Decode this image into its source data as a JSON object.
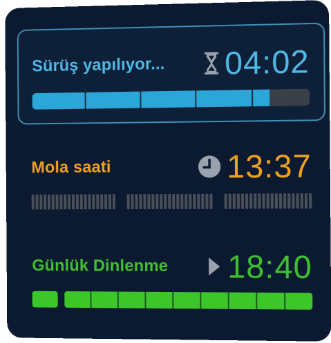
{
  "sections": {
    "driving": {
      "label": "Sürüş yapılıyor...",
      "time": "04:02",
      "icon": "hourglass-icon",
      "color": "#4fb8e6",
      "progress_fraction": 0.86
    },
    "break": {
      "label": "Mola saati",
      "time": "13:37",
      "icon": "clock-icon",
      "color": "#f0a020"
    },
    "rest": {
      "label": "Günlük Dinlenme",
      "time": "18:40",
      "icon": "play-arrow-icon",
      "color": "#40c030"
    }
  }
}
